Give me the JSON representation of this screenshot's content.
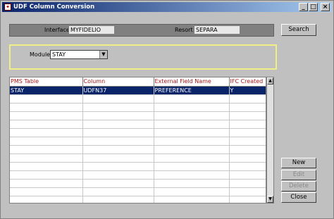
{
  "window": {
    "title": "UDF Column Conversion",
    "icon_name": "app-icon",
    "controls": {
      "minimize": "_",
      "maximize": "□",
      "close": "×"
    }
  },
  "header": {
    "interface_label": "Interface",
    "interface_value": "MYFIDELIO",
    "resort_label": "Resort",
    "resort_value": "SEPARA"
  },
  "filter": {
    "module_label": "Module",
    "module_value": "STAY"
  },
  "table": {
    "columns": [
      "PMS Table",
      "Column",
      "External Field Name",
      "IFC Created"
    ],
    "rows": [
      [
        "STAY",
        "UDFN37",
        "PREFERENCE",
        "Y"
      ]
    ],
    "empty_rows": 13
  },
  "buttons": {
    "search": "Search",
    "new": "New",
    "edit": "Edit",
    "delete": "Delete",
    "close": "Close"
  },
  "colors": {
    "title_bar": "#0a246a",
    "selection": "#0a246a",
    "header_text": "#a31a1a",
    "filter_border": "#f0ef86"
  }
}
